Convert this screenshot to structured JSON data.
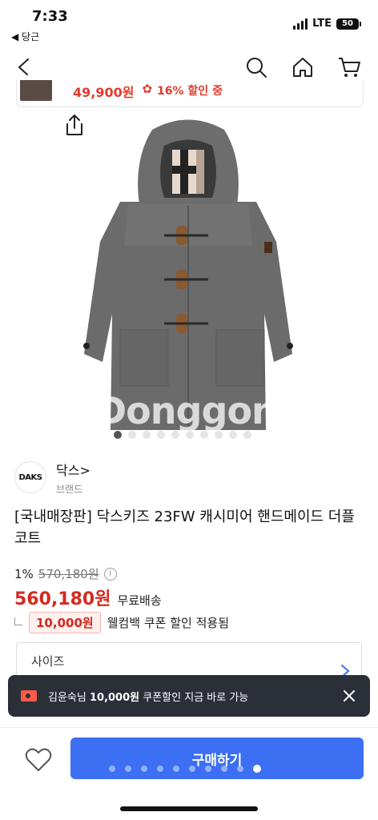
{
  "status_bar": {
    "time": "7:33",
    "back_app": "◀ 당근",
    "network": "LTE",
    "battery": "50"
  },
  "header": {
    "icons": [
      "back-icon",
      "search-icon",
      "home-icon",
      "cart-icon"
    ]
  },
  "promo": {
    "price": "49,900원",
    "discount": "16% 할인 중"
  },
  "gallery": {
    "watermark": "Donggone",
    "image_count": 10,
    "active_index": 0
  },
  "brand": {
    "logo_text": "DAKS",
    "name": "닥스>",
    "sub": "브랜드"
  },
  "product": {
    "title": "[국내매장판] 닥스키즈 23FW 캐시미어 핸드메이드 더플 코트",
    "discount_pct": "1%",
    "original_price": "570,180원",
    "price": "560,180원",
    "shipping": "무료배송",
    "coupon_badge": "10,000원",
    "coupon_desc": "웰컴백 쿠폰 할인 적용됨"
  },
  "size_selector": {
    "label": "사이즈"
  },
  "toast": {
    "prefix": "김윤숙님 ",
    "amount": "10,000원",
    "suffix": " 쿠폰할인 지금 바로 가능"
  },
  "bottom_bar": {
    "buy_label": "구매하기",
    "dot_count": 10,
    "active_dot": 9
  },
  "colors": {
    "accent": "#3c6ff2",
    "price_red": "#d42a1f",
    "toast_bg": "#2b3038",
    "coat_gray": "#6b6b6b"
  }
}
